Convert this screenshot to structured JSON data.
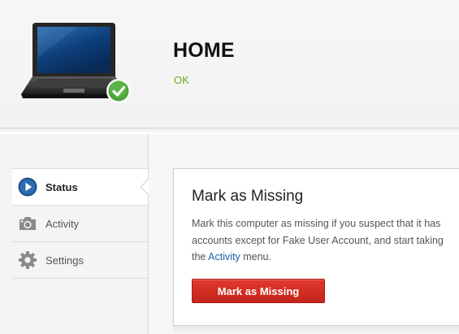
{
  "header": {
    "device_name": "HOME",
    "status_text": "OK",
    "device_icon": "laptop-icon",
    "status_icon": "check-badge-icon",
    "status_color": "#6aa81f"
  },
  "sidebar": {
    "items": [
      {
        "label": "Status",
        "icon": "play-circle-icon",
        "active": true
      },
      {
        "label": "Activity",
        "icon": "camera-icon",
        "active": false
      },
      {
        "label": "Settings",
        "icon": "gear-icon",
        "active": false
      }
    ]
  },
  "panel": {
    "title": "Mark as Missing",
    "description": {
      "line1": "Mark this computer as missing if you suspect that it has",
      "line2": "accounts except for Fake User Account, and start taking",
      "line3_prefix": "the ",
      "line3_link": "Activity",
      "line3_suffix": " menu."
    },
    "button_label": "Mark as Missing",
    "button_color": "#d3281e",
    "link_color": "#1f5fa8"
  }
}
